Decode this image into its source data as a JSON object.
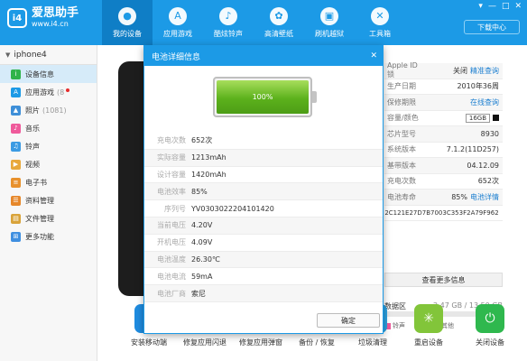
{
  "app": {
    "logo_mark": "i4",
    "name": "爱思助手",
    "url": "www.i4.cn",
    "download_center": "下载中心",
    "window_controls": [
      "▾",
      "—",
      "□",
      "✕"
    ]
  },
  "nav": [
    {
      "label": "我的设备",
      "icon": "apple-icon",
      "glyph": "",
      "active": true
    },
    {
      "label": "应用游戏",
      "icon": "app-store-icon",
      "glyph": "A",
      "active": false
    },
    {
      "label": "酷炫铃声",
      "icon": "bell-icon",
      "glyph": "♪",
      "active": false
    },
    {
      "label": "高清壁纸",
      "icon": "wallpaper-icon",
      "glyph": "✿",
      "active": false
    },
    {
      "label": "刷机越狱",
      "icon": "box-icon",
      "glyph": "▣",
      "active": false
    },
    {
      "label": "工具箱",
      "icon": "tools-icon",
      "glyph": "✕",
      "active": false
    }
  ],
  "sidebar": {
    "device": "iphone4",
    "items": [
      {
        "label": "设备信息",
        "icon": "info-icon",
        "color": "#2fb34a",
        "glyph": "i",
        "count": "",
        "active": true
      },
      {
        "label": "应用游戏",
        "icon": "apps-icon",
        "color": "#1c9ae6",
        "glyph": "A",
        "count": "(8",
        "active": false
      },
      {
        "label": "照片",
        "icon": "photo-icon",
        "color": "#3e8fd8",
        "glyph": "▲",
        "count": "(1081)",
        "active": false
      },
      {
        "label": "音乐",
        "icon": "music-icon",
        "color": "#ef5a9b",
        "glyph": "♪",
        "count": "",
        "active": false
      },
      {
        "label": "铃声",
        "icon": "ringtone-icon",
        "color": "#3c9be3",
        "glyph": "♫",
        "count": "",
        "active": false
      },
      {
        "label": "视频",
        "icon": "video-icon",
        "color": "#e8a83b",
        "glyph": "▶",
        "count": "",
        "active": false
      },
      {
        "label": "电子书",
        "icon": "ebook-icon",
        "color": "#e8912c",
        "glyph": "≡",
        "count": "",
        "active": false
      },
      {
        "label": "资料管理",
        "icon": "data-icon",
        "color": "#e6872a",
        "glyph": "☰",
        "count": "",
        "active": false
      },
      {
        "label": "文件管理",
        "icon": "file-icon",
        "color": "#d9a33a",
        "glyph": "▤",
        "count": "",
        "active": false
      },
      {
        "label": "更多功能",
        "icon": "more-icon",
        "color": "#3f8fe0",
        "glyph": "⊞",
        "count": "",
        "active": false
      }
    ]
  },
  "device_info": [
    {
      "label": "Apple ID锁",
      "value": "关闭",
      "link": "精准查询"
    },
    {
      "label": "生产日期",
      "value": "2010年36周",
      "link": ""
    },
    {
      "label": "保修期限",
      "value": "",
      "link": "在线查询"
    },
    {
      "label": "容量/颜色",
      "value": "16GB",
      "link": ""
    },
    {
      "label": "芯片型号",
      "value": "8930",
      "link": ""
    },
    {
      "label": "系统版本",
      "value": "7.1.2(11D257)",
      "link": ""
    },
    {
      "label": "基带版本",
      "value": "04.12.09",
      "link": ""
    },
    {
      "label": "充电次数",
      "value": "652次",
      "link": ""
    },
    {
      "label": "电池寿命",
      "value": "85%",
      "link": "电池详情"
    },
    {
      "label": "",
      "value": "2C121E27D7B7003C353F2A79F962",
      "link": ""
    }
  ],
  "more_info_button": "查看更多信息",
  "storage": {
    "label": "数据区",
    "value": "2.47 GB / 13.50 GB"
  },
  "legend": [
    {
      "label": "铃声",
      "color": "#ef5a9b"
    },
    {
      "label": "其他",
      "color": "#7bc24a"
    },
    {
      "label": "剩余",
      "color": "#e0e0e0"
    }
  ],
  "tools": [
    {
      "label": "安装移动端",
      "icon": "install-mobile-icon",
      "color": "#1f8ce0",
      "glyph": "i4"
    },
    {
      "label": "修复应用闪退",
      "icon": "fix-crash-icon",
      "color": "#27a0e4",
      "glyph": "✚"
    },
    {
      "label": "修复应用弹窗",
      "icon": "fix-popup-icon",
      "color": "#2f9be0",
      "glyph": "☒"
    },
    {
      "label": "备份 / 恢复",
      "icon": "backup-icon",
      "color": "#e8a030",
      "glyph": "↻"
    },
    {
      "label": "垃圾清理",
      "icon": "cleanup-icon",
      "color": "#2aa0e0",
      "glyph": "♻"
    },
    {
      "label": "重启设备",
      "icon": "restart-icon",
      "color": "#82c53a",
      "glyph": "✳"
    },
    {
      "label": "关闭设备",
      "icon": "power-icon",
      "color": "#2fb84e",
      "glyph": "⏻"
    }
  ],
  "modal": {
    "title": "电池详细信息",
    "battery_level": 100,
    "battery_label": "100%",
    "rows": [
      {
        "label": "充电次数",
        "value": "652次"
      },
      {
        "label": "实际容量",
        "value": "1213mAh"
      },
      {
        "label": "设计容量",
        "value": "1420mAh"
      },
      {
        "label": "电池效率",
        "value": "85%"
      },
      {
        "label": "序列号",
        "value": "YV0303022204101420"
      },
      {
        "label": "当前电压",
        "value": "4.20V"
      },
      {
        "label": "开机电压",
        "value": "4.09V"
      },
      {
        "label": "电池温度",
        "value": "26.30℃"
      },
      {
        "label": "电池电流",
        "value": "59mA"
      },
      {
        "label": "电池厂商",
        "value": "索尼"
      }
    ],
    "ok_button": "确定"
  }
}
